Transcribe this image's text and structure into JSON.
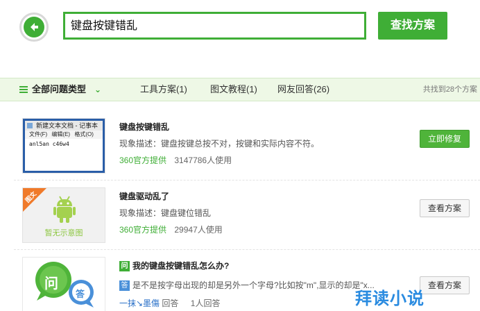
{
  "search": {
    "query": "键盘按键错乱",
    "button_label": "查找方案"
  },
  "filter": {
    "all_types": "全部问题类型",
    "tools": "工具方案(1)",
    "tutorials": "图文教程(1)",
    "qa": "网友回答(26)",
    "count": "共找到28个方案"
  },
  "results": [
    {
      "title": "键盘按键错乱",
      "desc": "现象描述：键盘按键总按不对，按键和实际内容不符。",
      "source": "360官方提供",
      "users": "3147786人使用",
      "button": "立即修复",
      "thumb": {
        "window_title": "新建文本文档 - 记事本",
        "menu": "文件(F) 编辑(E) 格式(O)",
        "content": "anl5an c46w4"
      }
    },
    {
      "title": "键盘驱动乱了",
      "desc": "现象描述：键盘键位错乱",
      "source": "360官方提供",
      "users": "29947人使用",
      "button": "查看方案",
      "thumb": {
        "badge": "图文",
        "caption": "暂无示意图"
      }
    },
    {
      "q_badge": "问",
      "title": "我的键盘按键错乱怎么办?",
      "a_badge": "答",
      "desc": "是不是按字母出现的却是另外一个字母?比如按\"m\",显示的却是\"x...",
      "asker": "一抹↘墨傷",
      "answer_label": "回答",
      "answers": "1人回答",
      "button": "查看方案",
      "thumb": {
        "q": "问",
        "a": "答"
      }
    }
  ],
  "watermark": "拜读小说",
  "colors": {
    "accent": "#3fae36",
    "filter_bg": "#eef8e6",
    "link": "#2a70c8"
  }
}
